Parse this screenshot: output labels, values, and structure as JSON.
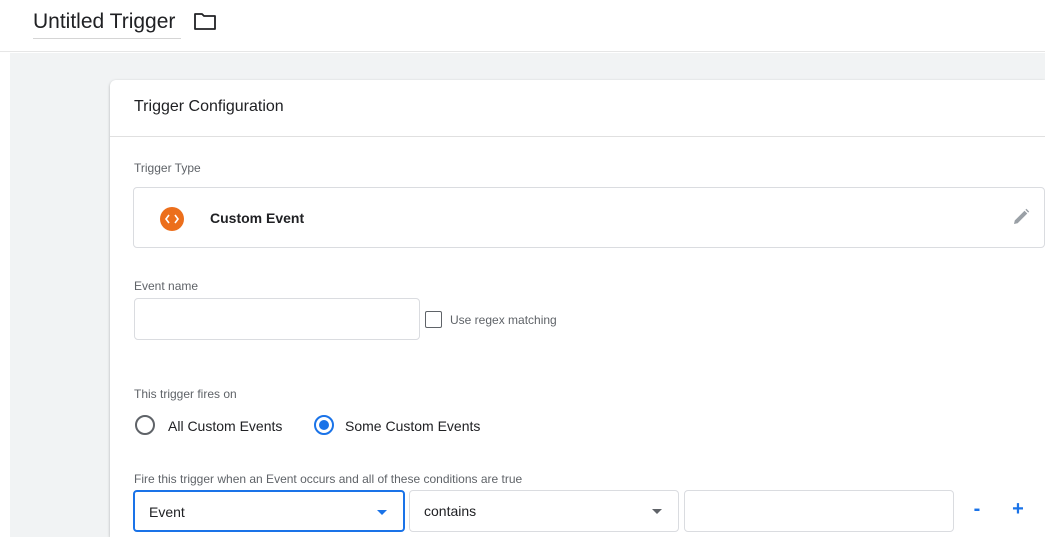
{
  "header": {
    "title": "Untitled Trigger",
    "folder_icon": "folder-icon"
  },
  "card": {
    "title": "Trigger Configuration",
    "trigger_type_label": "Trigger Type",
    "trigger_type": {
      "name": "Custom Event",
      "icon": "custom-event-code-icon",
      "icon_color": "#ec6f1c",
      "edit_icon": "pencil-icon"
    },
    "event_name": {
      "label": "Event name",
      "value": "",
      "regex_label": "Use regex matching",
      "regex_checked": false
    },
    "fires_on": {
      "label": "This trigger fires on",
      "options": [
        {
          "label": "All Custom Events",
          "checked": false
        },
        {
          "label": "Some Custom Events",
          "checked": true
        }
      ]
    },
    "conditions": {
      "label": "Fire this trigger when an Event occurs and all of these conditions are true",
      "variable": "Event",
      "operator": "contains",
      "value": "",
      "remove_label": "-",
      "add_label": "+"
    }
  },
  "colors": {
    "accent": "#1a73e8",
    "canvas": "#f1f3f4",
    "border": "#dadce0"
  }
}
